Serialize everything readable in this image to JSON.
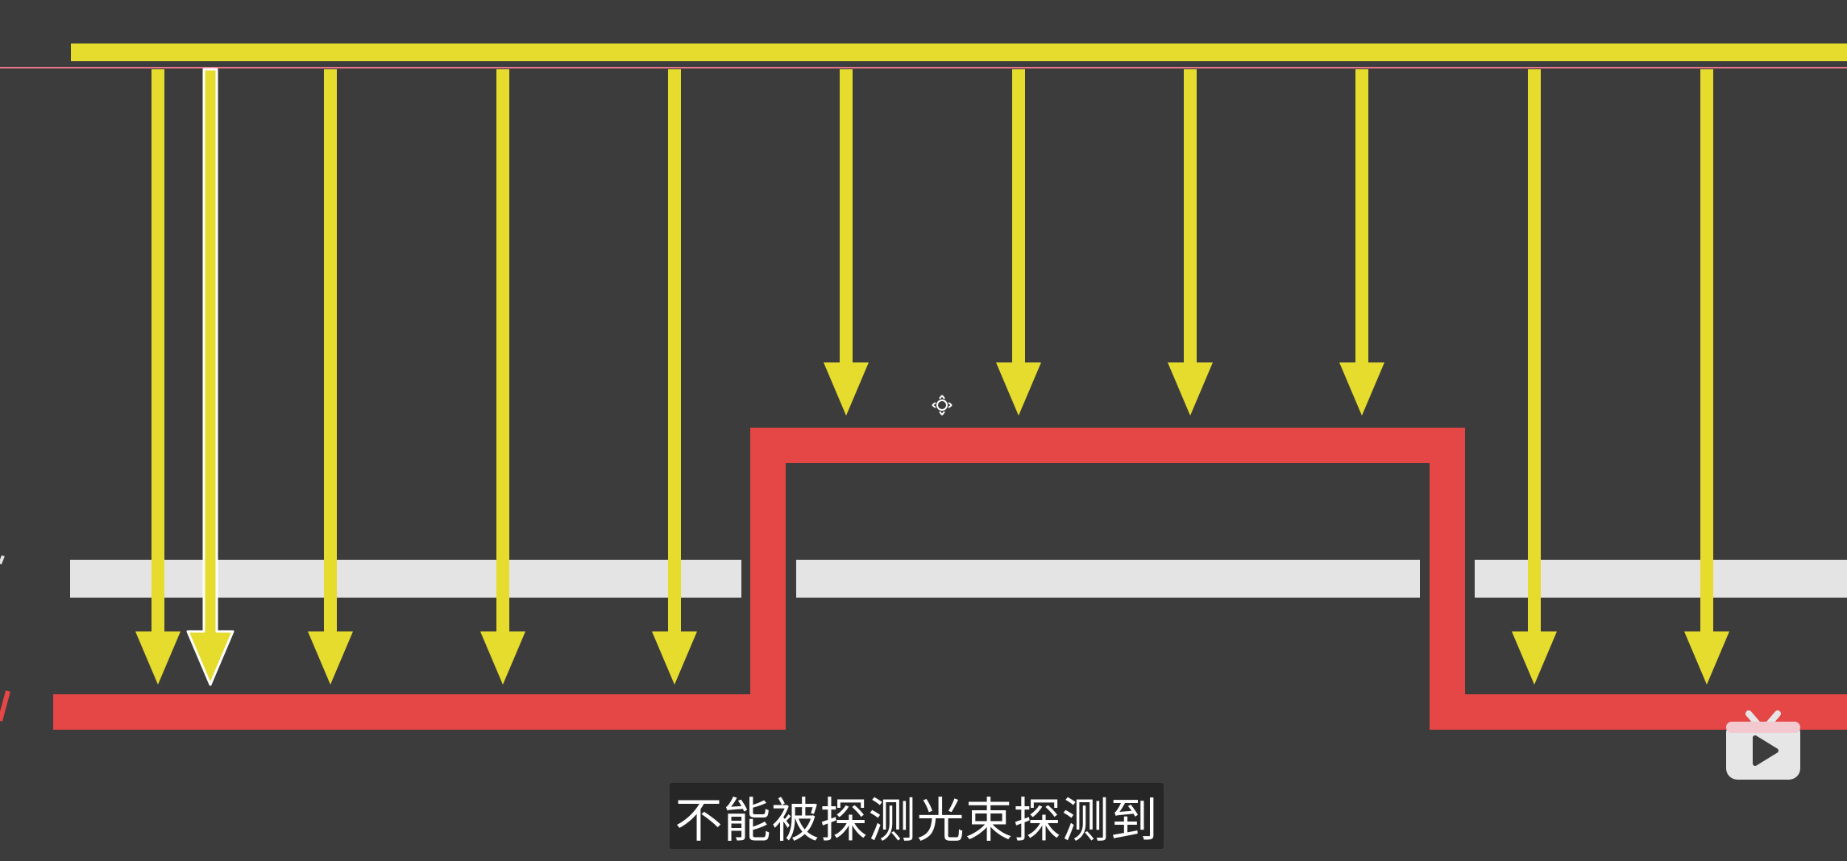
{
  "subtitle": {
    "text": "不能被探测光束探测到"
  },
  "colors": {
    "background": "#3c3c3c",
    "beam": "#e6dc2e",
    "beam_selected_outline": "#ffffff",
    "surface": "#e54646",
    "detector_strip": "#e4e4e4",
    "guide_line": "#e8768a",
    "subtitle_bg": "#262626"
  },
  "diagram": {
    "beam_count": 11,
    "selected_beam_index": 1,
    "short_beam_indices": [
      5,
      6,
      7,
      8
    ]
  },
  "icons": {
    "cursor": "move-cursor-icon",
    "watermark": "bilibili-tv-icon"
  }
}
